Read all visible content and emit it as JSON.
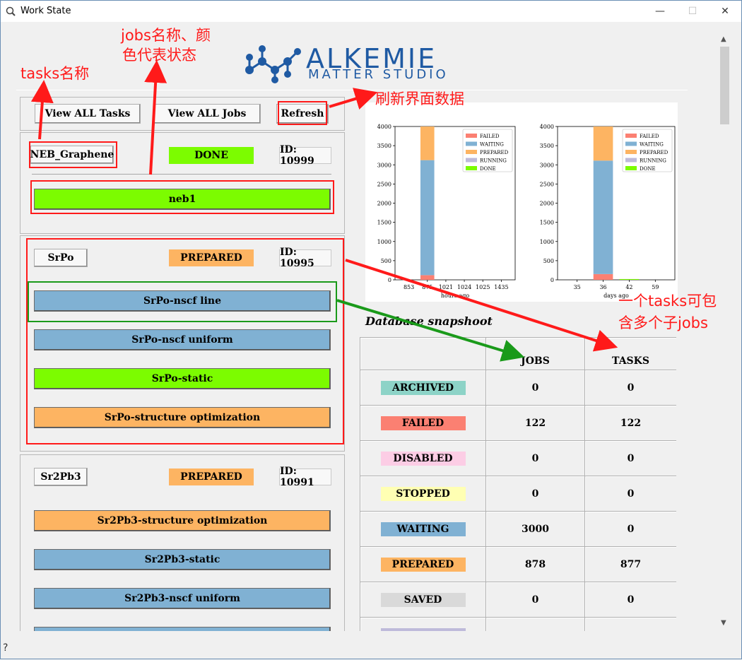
{
  "window": {
    "title": "Work State",
    "icon": "magnifier-app-icon",
    "minimize": "—",
    "maximize": "☐",
    "close": "✕"
  },
  "logo": {
    "line1": "ALKEMIE",
    "line2": "MATTER STUDIO",
    "brand_color": "#1f5aa3"
  },
  "toolbar": {
    "view_all_tasks": "View ALL Tasks",
    "view_all_jobs": "View ALL Jobs",
    "refresh": "Refresh"
  },
  "colors": {
    "done": "#7cfc00",
    "prepared": "#fdb462",
    "waiting": "#80b1d3",
    "failed": "#fb8072",
    "archived": "#8dd3c7",
    "disabled": "#fccde5",
    "stopped": "#ffffb3",
    "saved": "#d9d9d9",
    "running": "#bebada"
  },
  "tasks": [
    {
      "name": "NEB_Graphene",
      "status": "DONE",
      "id": "ID: 10999",
      "jobs": [
        {
          "name": "neb1",
          "status": "DONE"
        }
      ]
    },
    {
      "name": "SrPo",
      "status": "PREPARED",
      "id": "ID: 10995",
      "jobs": [
        {
          "name": "SrPo-nscf line",
          "status": "WAITING"
        },
        {
          "name": "SrPo-nscf uniform",
          "status": "WAITING"
        },
        {
          "name": "SrPo-static",
          "status": "DONE"
        },
        {
          "name": "SrPo-structure optimization",
          "status": "PREPARED"
        }
      ]
    },
    {
      "name": "Sr2Pb3",
      "status": "PREPARED",
      "id": "ID: 10991",
      "jobs": [
        {
          "name": "Sr2Pb3-structure optimization",
          "status": "PREPARED"
        },
        {
          "name": "Sr2Pb3-static",
          "status": "WAITING"
        },
        {
          "name": "Sr2Pb3-nscf uniform",
          "status": "WAITING"
        },
        {
          "name": "",
          "status": "WAITING"
        }
      ]
    }
  ],
  "chart_data": [
    {
      "type": "bar",
      "stacked": true,
      "xlabel": "hours ago",
      "ylabel": "",
      "categories": [
        "853",
        "875",
        "1021",
        "1024",
        "1025",
        "1435"
      ],
      "ylim": [
        0,
        4000
      ],
      "yticks": [
        0,
        500,
        1000,
        1500,
        2000,
        2500,
        3000,
        3500,
        4000
      ],
      "legend_position": "top-right",
      "series": [
        {
          "name": "FAILED",
          "color": "#fb8072",
          "values": [
            0,
            122,
            0,
            0,
            0,
            0
          ]
        },
        {
          "name": "WAITING",
          "color": "#80b1d3",
          "values": [
            0,
            3000,
            0,
            0,
            0,
            0
          ]
        },
        {
          "name": "PREPARED",
          "color": "#fdb462",
          "values": [
            0,
            878,
            0,
            0,
            0,
            0
          ]
        },
        {
          "name": "RUNNING",
          "color": "#bebada",
          "values": [
            0,
            0,
            0,
            0,
            0,
            0
          ]
        },
        {
          "name": "DONE",
          "color": "#7cfc00",
          "values": [
            0,
            0,
            0,
            0,
            0,
            0
          ]
        }
      ]
    },
    {
      "type": "bar",
      "stacked": true,
      "xlabel": "days ago",
      "ylabel": "",
      "categories": [
        "35",
        "36",
        "42",
        "59"
      ],
      "ylim": [
        0,
        4000
      ],
      "yticks": [
        0,
        500,
        1000,
        1500,
        2000,
        2500,
        3000,
        3500,
        4000
      ],
      "legend_position": "top-right",
      "series": [
        {
          "name": "FAILED",
          "color": "#fb8072",
          "values": [
            0,
            150,
            0,
            0
          ]
        },
        {
          "name": "WAITING",
          "color": "#80b1d3",
          "values": [
            0,
            2960,
            0,
            0
          ]
        },
        {
          "name": "PREPARED",
          "color": "#fdb462",
          "values": [
            0,
            890,
            0,
            0
          ]
        },
        {
          "name": "RUNNING",
          "color": "#bebada",
          "values": [
            0,
            0,
            0,
            0
          ]
        },
        {
          "name": "DONE",
          "color": "#7cfc00",
          "values": [
            0,
            0,
            20,
            0
          ]
        }
      ]
    }
  ],
  "snapshot": {
    "title": "Database snapshoot",
    "headers": [
      "",
      "JOBS",
      "TASKS"
    ],
    "rows": [
      {
        "state": "ARCHIVED",
        "color": "#8dd3c7",
        "jobs": "0",
        "tasks": "0"
      },
      {
        "state": "FAILED",
        "color": "#fb8072",
        "jobs": "122",
        "tasks": "122"
      },
      {
        "state": "DISABLED",
        "color": "#fccde5",
        "jobs": "0",
        "tasks": "0"
      },
      {
        "state": "STOPPED",
        "color": "#ffffb3",
        "jobs": "0",
        "tasks": "0"
      },
      {
        "state": "WAITING",
        "color": "#80b1d3",
        "jobs": "3000",
        "tasks": "0"
      },
      {
        "state": "PREPARED",
        "color": "#fdb462",
        "jobs": "878",
        "tasks": "877"
      },
      {
        "state": "SAVED",
        "color": "#d9d9d9",
        "jobs": "0",
        "tasks": "0"
      },
      {
        "state": "",
        "color": "#bebada",
        "jobs": "",
        "tasks": ""
      }
    ]
  },
  "annotations": {
    "tasks_name": "tasks名称",
    "jobs_name_line1": "jobs名称、颜",
    "jobs_name_line2": "色代表状态",
    "refresh_note": "刷新界面数据",
    "contains_line1": "一个tasks可包",
    "contains_line2": "含多个子jobs"
  },
  "statusbar": {
    "help": "?"
  }
}
